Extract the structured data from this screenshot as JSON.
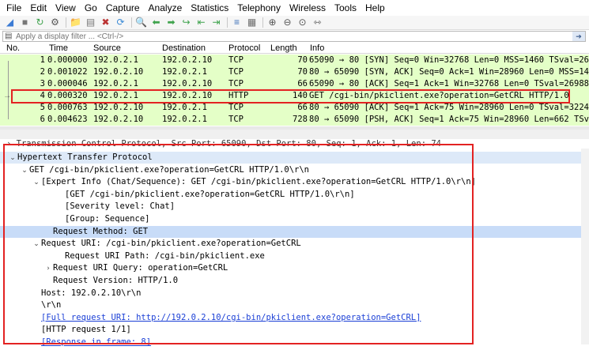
{
  "menu": [
    "File",
    "Edit",
    "View",
    "Go",
    "Capture",
    "Analyze",
    "Statistics",
    "Telephony",
    "Wireless",
    "Tools",
    "Help"
  ],
  "toolbar_icons": [
    "shark-fin-start-icon",
    "stop-square-icon",
    "restart-icon",
    "options-gear-icon",
    "open-folder-icon",
    "save-file-icon",
    "close-file-icon",
    "reload-icon",
    "find-magnifier-icon",
    "back-arrow-icon",
    "forward-arrow-icon",
    "go-to-packet-icon",
    "first-packet-icon",
    "last-packet-icon",
    "autoscroll-icon",
    "colorize-icon",
    "zoom-in-icon",
    "zoom-out-icon",
    "zoom-normal-icon",
    "resize-columns-icon"
  ],
  "filter": {
    "placeholder": "Apply a display filter ... <Ctrl-/>"
  },
  "packet_list": {
    "columns": [
      "No.",
      "Time",
      "Source",
      "Destination",
      "Protocol",
      "Length",
      "Info"
    ],
    "rows": [
      {
        "no": "1",
        "time": "0.000000",
        "src": "192.0.2.1",
        "dst": "192.0.2.10",
        "proto": "TCP",
        "len": "70",
        "info": "65090 → 80 [SYN] Seq=0 Win=32768 Len=0 MSS=1460 TSval=26"
      },
      {
        "no": "2",
        "time": "0.001022",
        "src": "192.0.2.10",
        "dst": "192.0.2.1",
        "proto": "TCP",
        "len": "70",
        "info": "80 → 65090 [SYN, ACK] Seq=0 Ack=1 Win=28960 Len=0 MSS=14"
      },
      {
        "no": "3",
        "time": "0.000046",
        "src": "192.0.2.1",
        "dst": "192.0.2.10",
        "proto": "TCP",
        "len": "66",
        "info": "65090 → 80 [ACK] Seq=1 Ack=1 Win=32768 Len=0 TSval=26988"
      },
      {
        "no": "4",
        "time": "0.000320",
        "src": "192.0.2.1",
        "dst": "192.0.2.10",
        "proto": "HTTP",
        "len": "140",
        "info": "GET /cgi-bin/pkiclient.exe?operation=GetCRL HTTP/1.0"
      },
      {
        "no": "5",
        "time": "0.000763",
        "src": "192.0.2.10",
        "dst": "192.0.2.1",
        "proto": "TCP",
        "len": "66",
        "info": "80 → 65090 [ACK] Seq=1 Ack=75 Win=28960 Len=0 TSval=3224"
      },
      {
        "no": "6",
        "time": "0.004623",
        "src": "192.0.2.10",
        "dst": "192.0.2.1",
        "proto": "TCP",
        "len": "728",
        "info": "80 → 65090 [PSH, ACK] Seq=1 Ack=75 Win=28960 Len=662 TSv"
      }
    ]
  },
  "details": {
    "tcp_summary": "Transmission Control Protocol, Src Port: 65090, Dst Port: 80, Seq: 1, Ack: 1, Len: 74",
    "lines": [
      {
        "text": "Hypertext Transfer Protocol",
        "indent": 0,
        "toggle": "v",
        "style": "alt",
        "link": false
      },
      {
        "text": "GET /cgi-bin/pkiclient.exe?operation=GetCRL HTTP/1.0\\r\\n",
        "indent": 1,
        "toggle": "v",
        "style": "",
        "link": false
      },
      {
        "text": "[Expert Info (Chat/Sequence): GET /cgi-bin/pkiclient.exe?operation=GetCRL HTTP/1.0\\r\\n]",
        "indent": 2,
        "toggle": "v",
        "style": "",
        "link": false
      },
      {
        "text": "[GET /cgi-bin/pkiclient.exe?operation=GetCRL HTTP/1.0\\r\\n]",
        "indent": 4,
        "toggle": "",
        "style": "",
        "link": false
      },
      {
        "text": "[Severity level: Chat]",
        "indent": 4,
        "toggle": "",
        "style": "",
        "link": false
      },
      {
        "text": "[Group: Sequence]",
        "indent": 4,
        "toggle": "",
        "style": "",
        "link": false
      },
      {
        "text": "Request Method: GET",
        "indent": 3,
        "toggle": "",
        "style": "sel",
        "link": false
      },
      {
        "text": "Request URI: /cgi-bin/pkiclient.exe?operation=GetCRL",
        "indent": 2,
        "toggle": "v",
        "style": "",
        "link": false
      },
      {
        "text": "Request URI Path: /cgi-bin/pkiclient.exe",
        "indent": 4,
        "toggle": "",
        "style": "",
        "link": false
      },
      {
        "text": "Request URI Query: operation=GetCRL",
        "indent": 3,
        "toggle": ">",
        "style": "",
        "link": false
      },
      {
        "text": "Request Version: HTTP/1.0",
        "indent": 3,
        "toggle": "",
        "style": "",
        "link": false
      },
      {
        "text": "Host: 192.0.2.10\\r\\n",
        "indent": 2,
        "toggle": "",
        "style": "",
        "link": false
      },
      {
        "text": "\\r\\n",
        "indent": 2,
        "toggle": "",
        "style": "",
        "link": false
      },
      {
        "text": "[Full request URI: http://192.0.2.10/cgi-bin/pkiclient.exe?operation=GetCRL]",
        "indent": 2,
        "toggle": "",
        "style": "",
        "link": true
      },
      {
        "text": "[HTTP request 1/1]",
        "indent": 2,
        "toggle": "",
        "style": "",
        "link": false
      },
      {
        "text": "[Response in frame: 8]",
        "indent": 2,
        "toggle": "",
        "style": "",
        "link": true
      }
    ]
  },
  "colors": {
    "tcp_row": "#e4ffc7",
    "selected_detail": "#c8dcf8",
    "highlight_box": "#e32222",
    "link": "#1a3fd6"
  }
}
